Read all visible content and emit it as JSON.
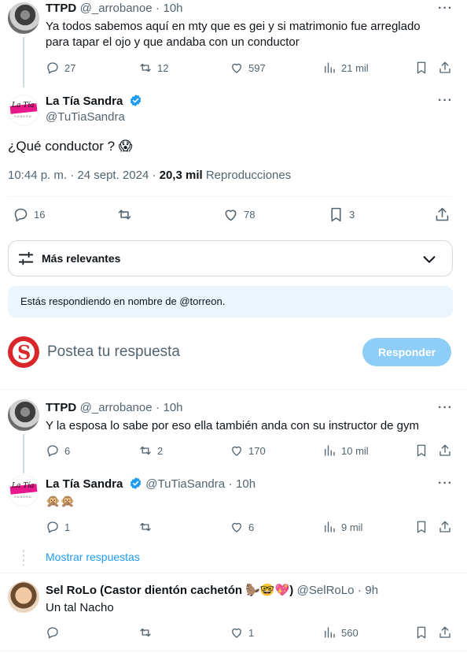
{
  "tweets": {
    "ttpd1": {
      "name": "TTPD",
      "handle": "@_arrobanoe",
      "sep": "·",
      "time": "10h",
      "text": "Ya todos sabemos aquí en mty que es gei y si matrimonio fue arreglado para tapar el ojo y que andaba con un conductor",
      "replies": "27",
      "reposts": "12",
      "likes": "597",
      "views": "21 mil"
    },
    "main": {
      "name": "La Tía Sandra",
      "handle": "@TuTiaSandra",
      "text": "¿Qué conductor ? 😱",
      "time": "10:44 p. m. · 24 sept. 2024 · ",
      "views_bold": "20,3 mil",
      "views_label": " Reproducciones",
      "replies": "16",
      "reposts": "",
      "likes": "78",
      "bookmarks": "3"
    },
    "ttpd2": {
      "name": "TTPD",
      "handle": "@_arrobanoe",
      "sep": "·",
      "time": "10h",
      "text": "Y la esposa lo sabe por eso ella también anda con su instructor de gym",
      "replies": "6",
      "reposts": "2",
      "likes": "170",
      "views": "10 mil"
    },
    "sandra2": {
      "name": "La Tía Sandra",
      "handle": "@TuTiaSandra",
      "sep": "·",
      "time": "10h",
      "text": "🙊🙊",
      "replies": "1",
      "reposts": "",
      "likes": "6",
      "views": "9 mil"
    },
    "rolo": {
      "name": "Sel RoLo (Castor dientón cachetón 🦫🤓💖)",
      "handle": "@SelRoLo",
      "sep": "·",
      "time": "9h",
      "text": "Un tal Nacho",
      "replies": "",
      "reposts": "",
      "likes": "1",
      "views": "560"
    }
  },
  "sort": {
    "label": "Más relevantes"
  },
  "notice": {
    "text": "Estás respondiendo en nombre de @torreon."
  },
  "composer": {
    "placeholder": "Postea tu respuesta",
    "button": "Responder"
  },
  "show_replies": "Mostrar respuestas",
  "logo": {
    "sandra_top": "La Tía",
    "sandra_bottom": "SANDRA",
    "torreon_letter": "S"
  },
  "colors": {
    "accent": "#1d9bf0",
    "button_disabled": "#8ecdf8",
    "verified": "#1d9bf0",
    "text": "#0f1419",
    "secondary": "#536471"
  },
  "icons": [
    "reply-icon",
    "repost-icon",
    "like-icon",
    "views-icon",
    "bookmark-icon",
    "share-icon",
    "more-icon",
    "verified-icon",
    "filter-icon",
    "chevron-down-icon"
  ]
}
